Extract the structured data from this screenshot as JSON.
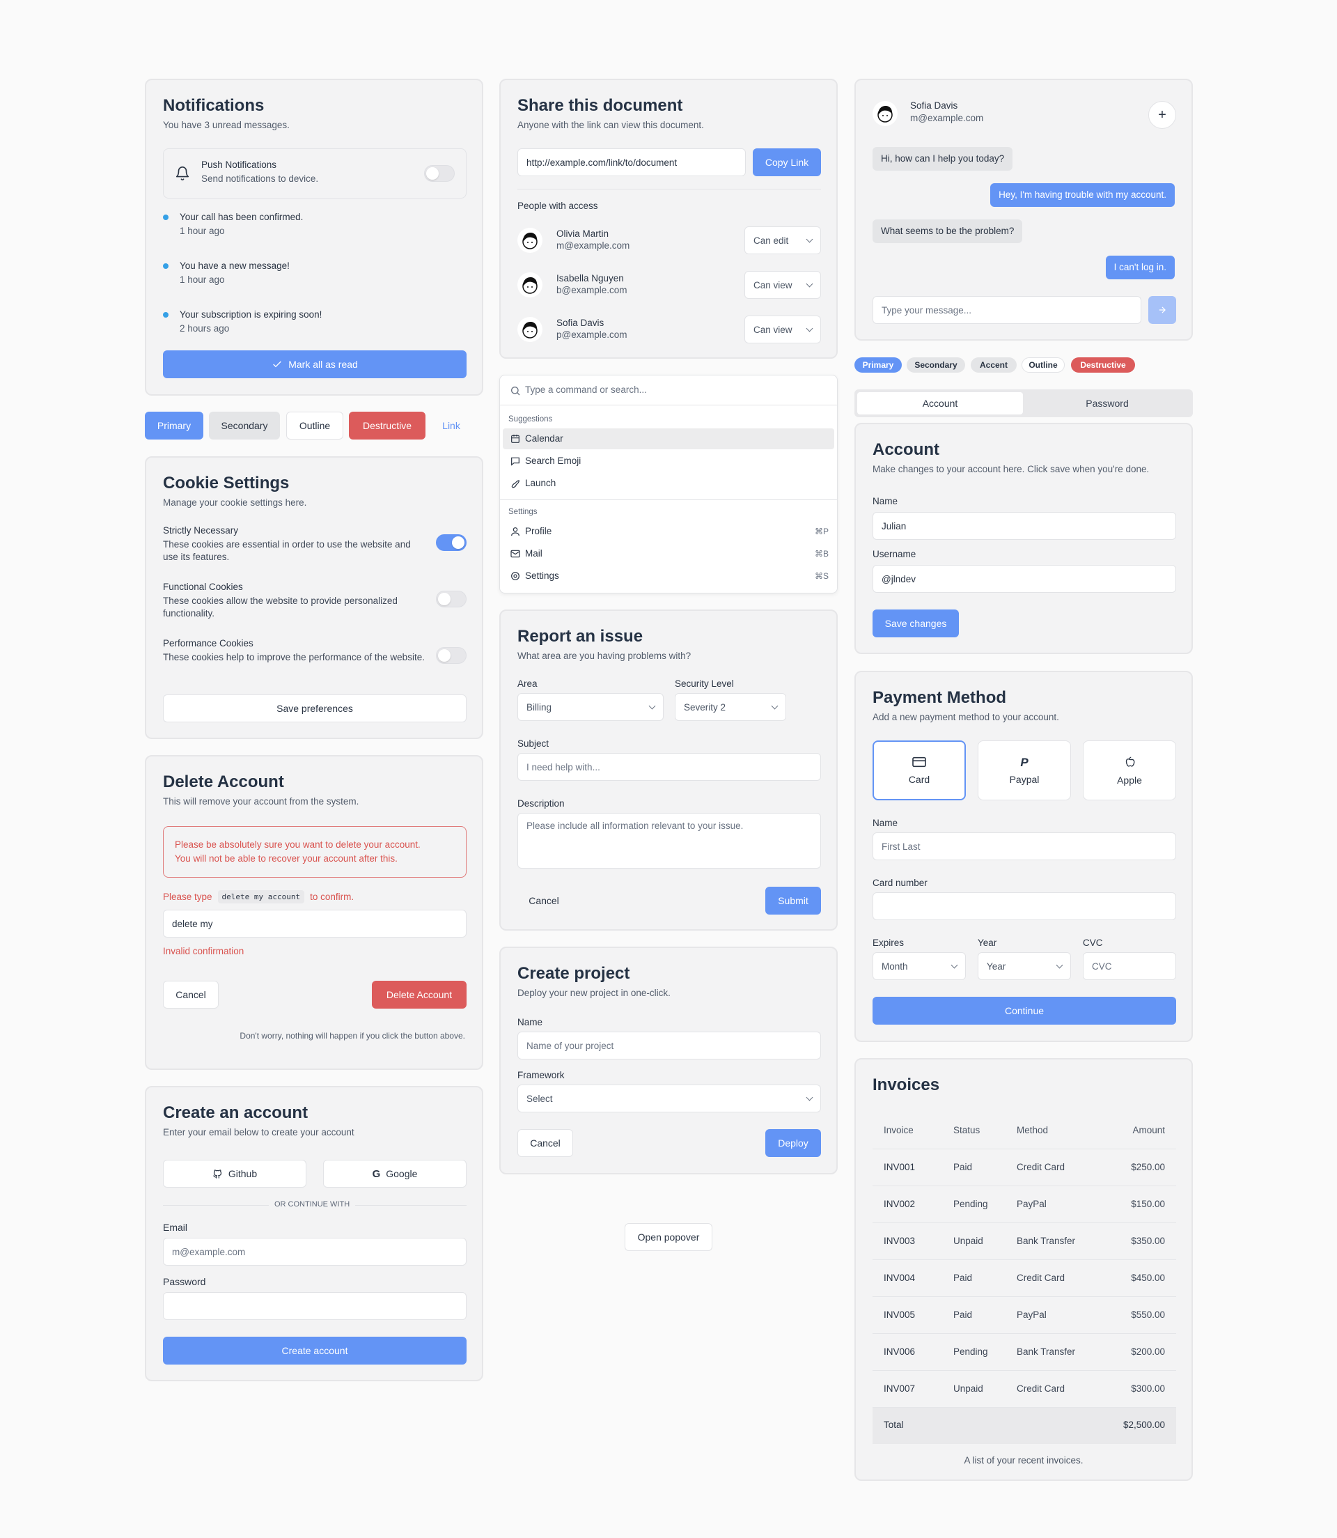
{
  "notifications": {
    "title": "Notifications",
    "subtitle": "You have 3 unread messages.",
    "push_title": "Push Notifications",
    "push_desc": "Send notifications to device.",
    "items": [
      {
        "text": "Your call has been confirmed.",
        "time": "1 hour ago"
      },
      {
        "text": "You have a new message!",
        "time": "1 hour ago"
      },
      {
        "text": "Your subscription is expiring soon!",
        "time": "2 hours ago"
      }
    ],
    "mark_all": "Mark all as read"
  },
  "buttons_row": {
    "primary": "Primary",
    "secondary": "Secondary",
    "outline": "Outline",
    "destructive": "Destructive",
    "link": "Link"
  },
  "cookies": {
    "title": "Cookie Settings",
    "subtitle": "Manage your cookie settings here.",
    "items": [
      {
        "title": "Strictly Necessary",
        "desc": "These cookies are essential in order to use the website and use its features.",
        "on": true
      },
      {
        "title": "Functional Cookies",
        "desc": "These cookies allow the website to provide personalized functionality.",
        "on": false
      },
      {
        "title": "Performance Cookies",
        "desc": "These cookies help to improve the performance of the website.",
        "on": false
      }
    ],
    "save": "Save preferences"
  },
  "delete_account": {
    "title": "Delete Account",
    "subtitle": "This will remove your account from the system.",
    "warning_1": "Please be absolutely sure you want to delete your account.",
    "warning_2": "You will not be able to recover your account after this.",
    "please_type": "Please type",
    "code": "delete my account",
    "to_confirm": "to confirm.",
    "input_value": "delete my",
    "error": "Invalid confirmation",
    "cancel": "Cancel",
    "delete": "Delete Account",
    "footnote": "Don't worry, nothing will happen if you click the button above."
  },
  "create_account": {
    "title": "Create an account",
    "subtitle": "Enter your email below to create your account",
    "github": "Github",
    "google": "Google",
    "divider": "OR CONTINUE WITH",
    "email_label": "Email",
    "email_placeholder": "m@example.com",
    "password_label": "Password",
    "submit": "Create account"
  },
  "share": {
    "title": "Share this document",
    "subtitle": "Anyone with the link can view this document.",
    "link": "http://example.com/link/to/document",
    "copy": "Copy Link",
    "people_label": "People with access",
    "people": [
      {
        "name": "Olivia Martin",
        "email": "m@example.com",
        "perm": "Can edit"
      },
      {
        "name": "Isabella Nguyen",
        "email": "b@example.com",
        "perm": "Can view"
      },
      {
        "name": "Sofia Davis",
        "email": "p@example.com",
        "perm": "Can view"
      }
    ]
  },
  "command": {
    "placeholder": "Type a command or search...",
    "group1": "Suggestions",
    "suggestions": [
      "Calendar",
      "Search Emoji",
      "Launch"
    ],
    "group2": "Settings",
    "settings": [
      {
        "label": "Profile",
        "kbd": "⌘P"
      },
      {
        "label": "Mail",
        "kbd": "⌘B"
      },
      {
        "label": "Settings",
        "kbd": "⌘S"
      }
    ]
  },
  "report": {
    "title": "Report an issue",
    "subtitle": "What area are you having problems with?",
    "area_label": "Area",
    "area_value": "Billing",
    "level_label": "Security Level",
    "level_value": "Severity 2",
    "subject_label": "Subject",
    "subject_placeholder": "I need help with...",
    "desc_label": "Description",
    "desc_placeholder": "Please include all information relevant to your issue.",
    "cancel": "Cancel",
    "submit": "Submit"
  },
  "project": {
    "title": "Create project",
    "subtitle": "Deploy your new project in one-click.",
    "name_label": "Name",
    "name_placeholder": "Name of your project",
    "framework_label": "Framework",
    "framework_value": "Select",
    "cancel": "Cancel",
    "deploy": "Deploy"
  },
  "popover": {
    "label": "Open popover"
  },
  "chat": {
    "name": "Sofia Davis",
    "email": "m@example.com",
    "messages": [
      {
        "text": "Hi, how can I help you today?",
        "from": "agent"
      },
      {
        "text": "Hey, I'm having trouble with my account.",
        "from": "user"
      },
      {
        "text": "What seems to be the problem?",
        "from": "agent"
      },
      {
        "text": "I can't log in.",
        "from": "user"
      }
    ],
    "input_placeholder": "Type your message..."
  },
  "badges": {
    "primary": "Primary",
    "secondary": "Secondary",
    "accent": "Accent",
    "outline": "Outline",
    "destructive": "Destructive"
  },
  "tabs": {
    "account": "Account",
    "password": "Password"
  },
  "account": {
    "title": "Account",
    "subtitle": "Make changes to your account here. Click save when you're done.",
    "name_label": "Name",
    "name_value": "Julian",
    "username_label": "Username",
    "username_value": "@jlndev",
    "save": "Save changes"
  },
  "payment": {
    "title": "Payment Method",
    "subtitle": "Add a new payment method to your account.",
    "methods": [
      "Card",
      "Paypal",
      "Apple"
    ],
    "name_label": "Name",
    "name_placeholder": "First Last",
    "card_label": "Card number",
    "expires_label": "Expires",
    "month": "Month",
    "year_label": "Year",
    "year": "Year",
    "cvc_label": "CVC",
    "cvc_placeholder": "CVC",
    "continue": "Continue"
  },
  "invoices": {
    "title": "Invoices",
    "headers": [
      "Invoice",
      "Status",
      "Method",
      "Amount"
    ],
    "rows": [
      [
        "INV001",
        "Paid",
        "Credit Card",
        "$250.00"
      ],
      [
        "INV002",
        "Pending",
        "PayPal",
        "$150.00"
      ],
      [
        "INV003",
        "Unpaid",
        "Bank Transfer",
        "$350.00"
      ],
      [
        "INV004",
        "Paid",
        "Credit Card",
        "$450.00"
      ],
      [
        "INV005",
        "Paid",
        "PayPal",
        "$550.00"
      ],
      [
        "INV006",
        "Pending",
        "Bank Transfer",
        "$200.00"
      ],
      [
        "INV007",
        "Unpaid",
        "Credit Card",
        "$300.00"
      ]
    ],
    "total_label": "Total",
    "total_value": "$2,500.00",
    "caption": "A list of your recent invoices."
  },
  "colors": {
    "primary": "#6394f5",
    "destructive": "#dc5b5b",
    "dot": "#35a0e6"
  }
}
